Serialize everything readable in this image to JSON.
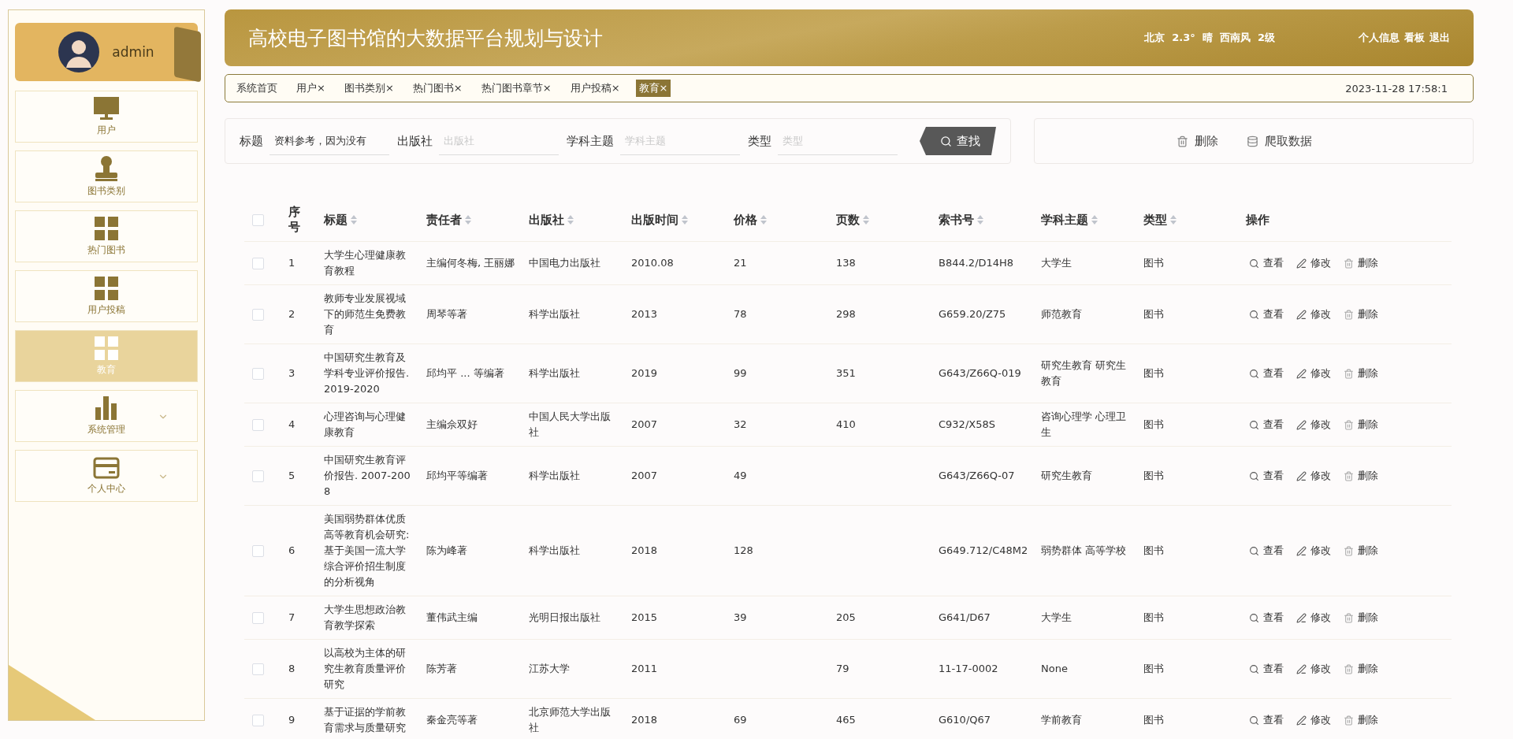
{
  "sidebar": {
    "user": {
      "name": "admin"
    },
    "items": [
      {
        "label": "用户",
        "kind": "link",
        "selected": false
      },
      {
        "label": "图书类别",
        "kind": "link",
        "selected": false
      },
      {
        "label": "热门图书",
        "kind": "link",
        "selected": false
      },
      {
        "label": "用户投稿",
        "kind": "link",
        "selected": false
      },
      {
        "label": "教育",
        "kind": "link",
        "selected": true
      },
      {
        "label": "系统管理",
        "kind": "menu",
        "selected": false
      },
      {
        "label": "个人中心",
        "kind": "menu",
        "selected": false
      }
    ]
  },
  "header": {
    "title": "高校电子图书馆的大数据平台规划与设计",
    "weather": "北京  2.3°  晴  西南风  2级",
    "links": [
      "个人信息",
      "看板",
      "退出"
    ]
  },
  "tabs": [
    {
      "label": "系统首页",
      "closable": false,
      "selected": false
    },
    {
      "label": "用户",
      "closable": true,
      "selected": false
    },
    {
      "label": "图书类别",
      "closable": true,
      "selected": false
    },
    {
      "label": "热门图书",
      "closable": true,
      "selected": false
    },
    {
      "label": "热门图书章节",
      "closable": true,
      "selected": false
    },
    {
      "label": "用户投稿",
      "closable": true,
      "selected": false
    },
    {
      "label": "教育",
      "closable": true,
      "selected": true
    }
  ],
  "close_mark": "×",
  "datetime": "2023-11-28 17:58:1",
  "search": {
    "fields": [
      {
        "label": "标题",
        "value": "资料参考，因为没有"
      },
      {
        "label": "出版社",
        "placeholder": "出版社"
      },
      {
        "label": "学科主题",
        "placeholder": "学科主题"
      },
      {
        "label": "类型",
        "placeholder": "类型"
      }
    ],
    "button": "查找"
  },
  "toolbar": [
    {
      "label": "删除",
      "kind": "delete"
    },
    {
      "label": "爬取数据",
      "kind": "crawl"
    }
  ],
  "table": {
    "columns": [
      {
        "label": "序号",
        "sortable": false
      },
      {
        "label": "标题",
        "sortable": true
      },
      {
        "label": "责任者",
        "sortable": true
      },
      {
        "label": "出版社",
        "sortable": true
      },
      {
        "label": "出版时间",
        "sortable": true
      },
      {
        "label": "价格",
        "sortable": true
      },
      {
        "label": "页数",
        "sortable": true
      },
      {
        "label": "索书号",
        "sortable": true
      },
      {
        "label": "学科主题",
        "sortable": true
      },
      {
        "label": "类型",
        "sortable": true
      },
      {
        "label": "操作",
        "sortable": false
      }
    ],
    "select_all": {
      "checked": false
    },
    "rows": [
      {
        "checked": false,
        "cells": [
          "1",
          "大学生心理健康教育教程",
          "主编何冬梅, 王丽娜",
          "中国电力出版社",
          "2010.08",
          "21",
          "138",
          "B844.2/D14H8",
          "大学生",
          "图书"
        ],
        "actions": [
          {
            "label": "查看",
            "kind": "view"
          },
          {
            "label": "修改",
            "kind": "edit"
          },
          {
            "label": "删除",
            "kind": "delete"
          }
        ]
      },
      {
        "checked": false,
        "cells": [
          "2",
          "教师专业发展视域下的师范生免费教育",
          "周琴等著",
          "科学出版社",
          "2013",
          "78",
          "298",
          "G659.20/Z75",
          "师范教育",
          "图书"
        ],
        "actions": [
          {
            "label": "查看",
            "kind": "view"
          },
          {
            "label": "修改",
            "kind": "edit"
          },
          {
            "label": "删除",
            "kind": "delete"
          }
        ]
      },
      {
        "checked": false,
        "cells": [
          "3",
          "中国研究生教育及学科专业评价报告. 2019-2020",
          "邱均平 ... 等编著",
          "科学出版社",
          "2019",
          "99",
          "351",
          "G643/Z66Q-019",
          "研究生教育 研究生教育",
          "图书"
        ],
        "actions": [
          {
            "label": "查看",
            "kind": "view"
          },
          {
            "label": "修改",
            "kind": "edit"
          },
          {
            "label": "删除",
            "kind": "delete"
          }
        ]
      },
      {
        "checked": false,
        "cells": [
          "4",
          "心理咨询与心理健康教育",
          "主编佘双好",
          "中国人民大学出版社",
          "2007",
          "32",
          "410",
          "C932/X58S",
          "咨询心理学 心理卫生",
          "图书"
        ],
        "actions": [
          {
            "label": "查看",
            "kind": "view"
          },
          {
            "label": "修改",
            "kind": "edit"
          },
          {
            "label": "删除",
            "kind": "delete"
          }
        ]
      },
      {
        "checked": false,
        "cells": [
          "5",
          "中国研究生教育评价报告. 2007-2008",
          "邱均平等编著",
          "科学出版社",
          "2007",
          "49",
          null,
          "G643/Z66Q-07",
          "研究生教育",
          "图书"
        ],
        "actions": [
          {
            "label": "查看",
            "kind": "view"
          },
          {
            "label": "修改",
            "kind": "edit"
          },
          {
            "label": "删除",
            "kind": "delete"
          }
        ]
      },
      {
        "checked": false,
        "cells": [
          "6",
          "美国弱势群体优质高等教育机会研究: 基于美国一流大学综合评价招生制度的分析视角",
          "陈为峰著",
          "科学出版社",
          "2018",
          "128",
          null,
          "G649.712/C48M2",
          "弱势群体 高等学校",
          "图书"
        ],
        "actions": [
          {
            "label": "查看",
            "kind": "view"
          },
          {
            "label": "修改",
            "kind": "edit"
          },
          {
            "label": "删除",
            "kind": "delete"
          }
        ]
      },
      {
        "checked": false,
        "cells": [
          "7",
          "大学生思想政治教育教学探索",
          "董伟武主编",
          "光明日报出版社",
          "2015",
          "39",
          "205",
          "G641/D67",
          "大学生",
          "图书"
        ],
        "actions": [
          {
            "label": "查看",
            "kind": "view"
          },
          {
            "label": "修改",
            "kind": "edit"
          },
          {
            "label": "删除",
            "kind": "delete"
          }
        ]
      },
      {
        "checked": false,
        "cells": [
          "8",
          "以高校为主体的研究生教育质量评价研究",
          "陈芳著",
          "江苏大学",
          "2011",
          null,
          "79",
          "11-17-0002",
          "None",
          "图书"
        ],
        "actions": [
          {
            "label": "查看",
            "kind": "view"
          },
          {
            "label": "修改",
            "kind": "edit"
          },
          {
            "label": "删除",
            "kind": "delete"
          }
        ]
      },
      {
        "checked": false,
        "cells": [
          "9",
          "基于证据的学前教育需求与质量研究",
          "秦金亮等著",
          "北京师范大学出版社",
          "2018",
          "69",
          "465",
          "G610/Q67",
          "学前教育",
          "图书"
        ],
        "actions": [
          {
            "label": "查看",
            "kind": "view"
          },
          {
            "label": "修改",
            "kind": "edit"
          },
          {
            "label": "删除",
            "kind": "delete"
          }
        ]
      }
    ]
  }
}
